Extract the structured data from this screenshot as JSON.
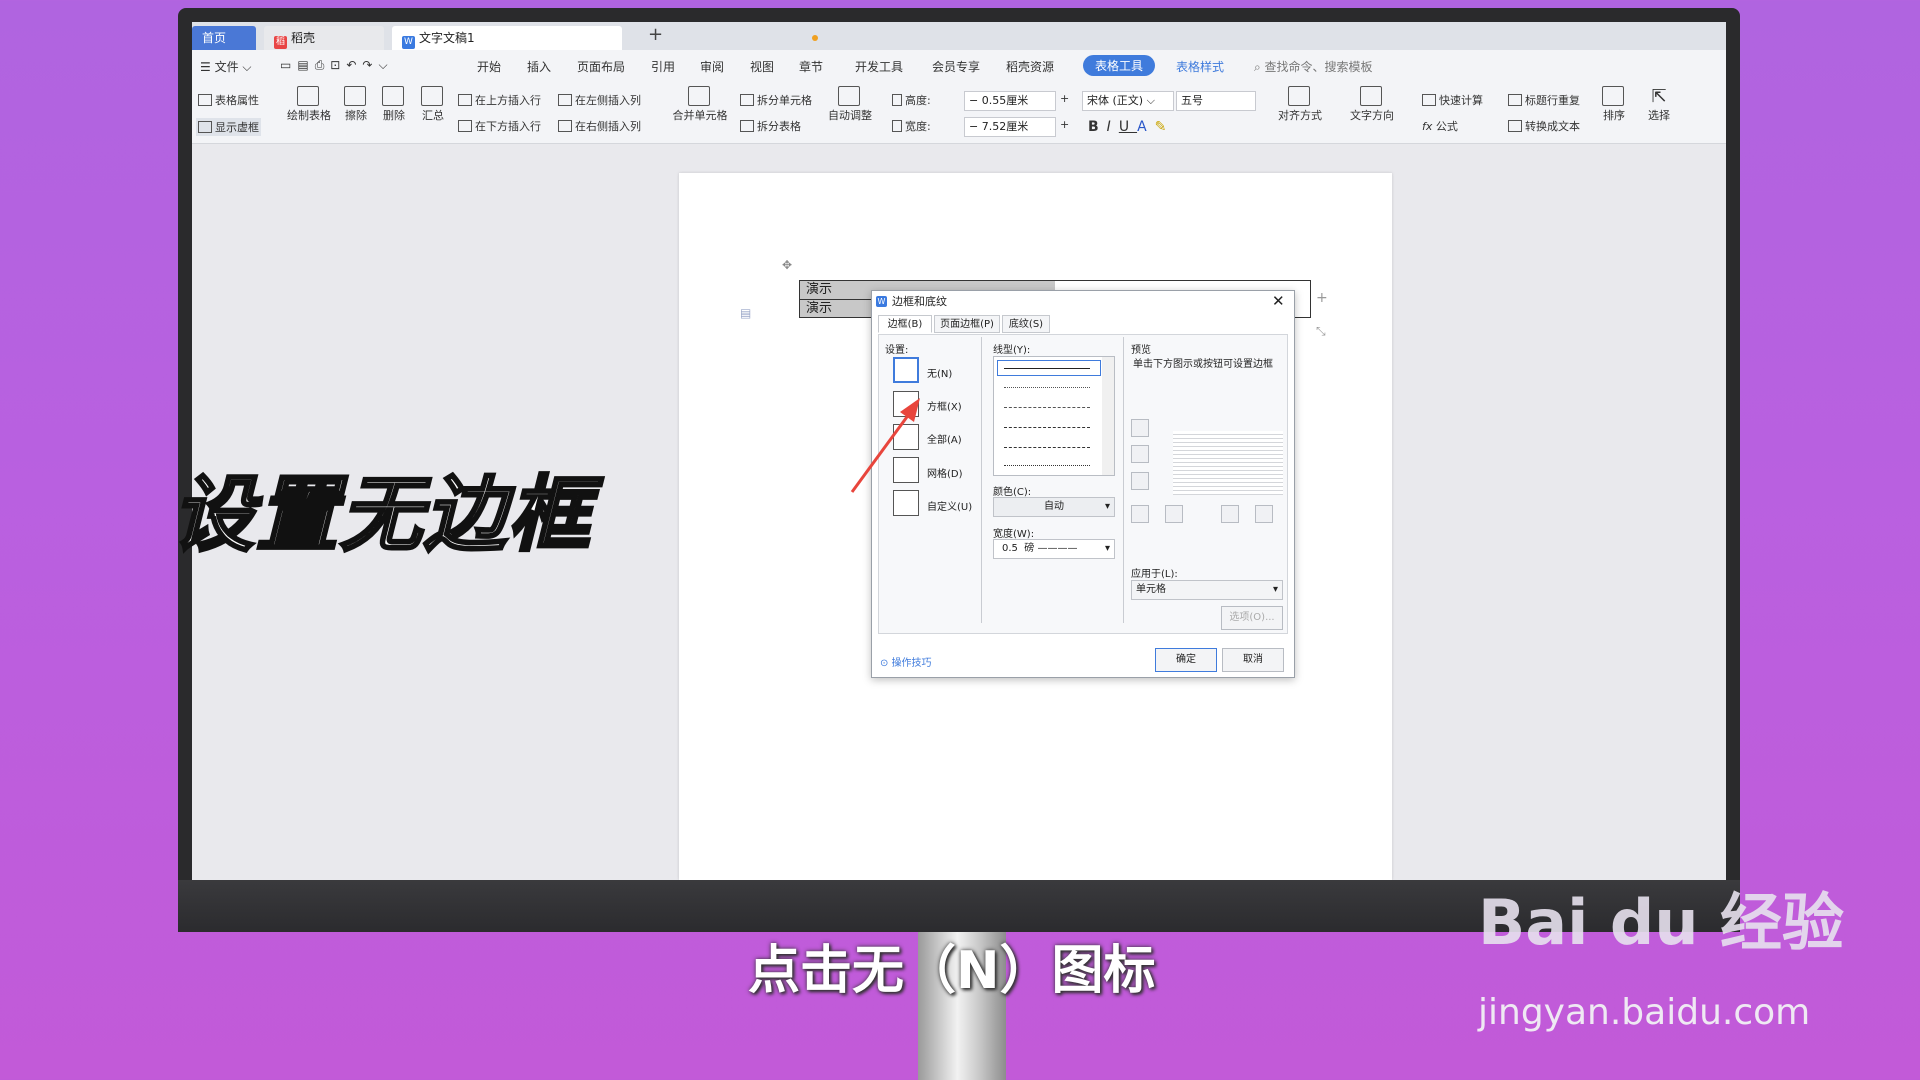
{
  "tabs": {
    "home": "首页",
    "daoke": "稻壳",
    "doc": "文字文稿1",
    "new_tab": "+"
  },
  "menu": [
    "文件",
    "开始",
    "插入",
    "页面布局",
    "引用",
    "审阅",
    "视图",
    "章节",
    "开发工具",
    "会员专享",
    "稻壳资源",
    "表格工具",
    "表格样式"
  ],
  "menu_search": "查找命令、搜索模板",
  "ribbon": {
    "table_props": "表格属性",
    "show_grid": "显示虚框",
    "draw_table": "绘制表格",
    "erase": "擦除",
    "delete": "删除",
    "summary": "汇总",
    "insert_above": "在上方插入行",
    "insert_below": "在下方插入行",
    "insert_left": "在左侧插入列",
    "insert_right": "在右侧插入列",
    "merge_cells": "合并单元格",
    "split_cells": "拆分单元格",
    "split_table": "拆分表格",
    "auto_adjust": "自动调整",
    "height_label": "高度:",
    "height_value": "0.55厘米",
    "width_label": "宽度:",
    "width_value": "7.52厘米",
    "font_name": "宋体 (正文)",
    "font_size": "五号",
    "align": "对齐方式",
    "text_dir": "文字方向",
    "quick_calc": "快速计算",
    "repeat_header": "标题行重复",
    "formula": "公式",
    "to_text": "转换成文本",
    "sort": "排序",
    "select": "选择"
  },
  "table_cells": [
    "演示",
    "演示"
  ],
  "dialog": {
    "title": "边框和底纹",
    "tabs": [
      "边框(B)",
      "页面边框(P)",
      "底纹(S)"
    ],
    "settings_label": "设置:",
    "settings": [
      "无(N)",
      "方框(X)",
      "全部(A)",
      "网格(D)",
      "自定义(U)"
    ],
    "line_style_label": "线型(Y):",
    "color_label": "颜色(C):",
    "color_value": "自动",
    "width_label": "宽度(W):",
    "width_value": "0.5",
    "width_unit": "磅",
    "preview_label": "预览",
    "preview_hint": "单击下方图示或按钮可设置边框",
    "apply_label": "应用于(L):",
    "apply_value": "单元格",
    "options_button": "选项(O)...",
    "tips": "操作技巧",
    "ok": "确定",
    "cancel": "取消"
  },
  "overlay": {
    "title": "设置无边框",
    "subtitle": "点击无（N）图标",
    "watermark_brand": "Bai du 经验",
    "watermark_url": "jingyan.baidu.com"
  },
  "colors": {
    "accent": "#3f7bdc",
    "background": "#b960e0",
    "arrow": "#e8453c"
  }
}
